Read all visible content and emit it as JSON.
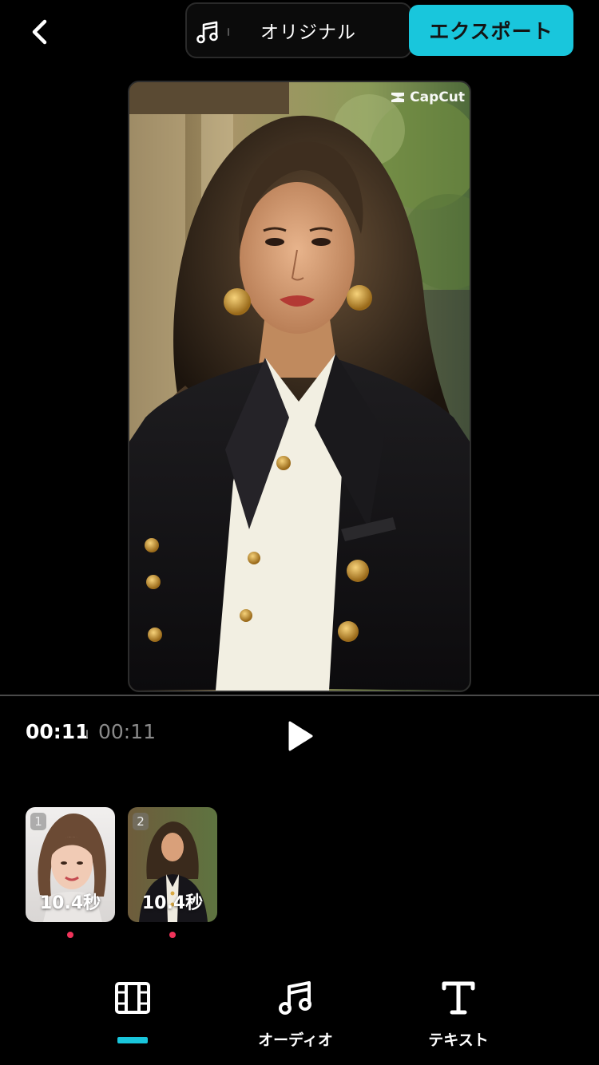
{
  "header": {
    "audio_track_label": "オリジナル",
    "export_label": "エクスポート"
  },
  "preview": {
    "watermark": "CapCut"
  },
  "playback": {
    "current_time": "00:11",
    "total_time": "00:11"
  },
  "clips": [
    {
      "index": "1",
      "duration": "10.4秒"
    },
    {
      "index": "2",
      "duration": "10.4秒"
    }
  ],
  "bottom_nav": {
    "items": [
      {
        "label": "",
        "icon": "film-icon"
      },
      {
        "label": "オーディオ",
        "icon": "music-note-icon"
      },
      {
        "label": "テキスト",
        "icon": "text-icon"
      }
    ]
  },
  "colors": {
    "accent": "#19c6dc",
    "clip_dot": "#f0335a",
    "background": "#000000"
  }
}
